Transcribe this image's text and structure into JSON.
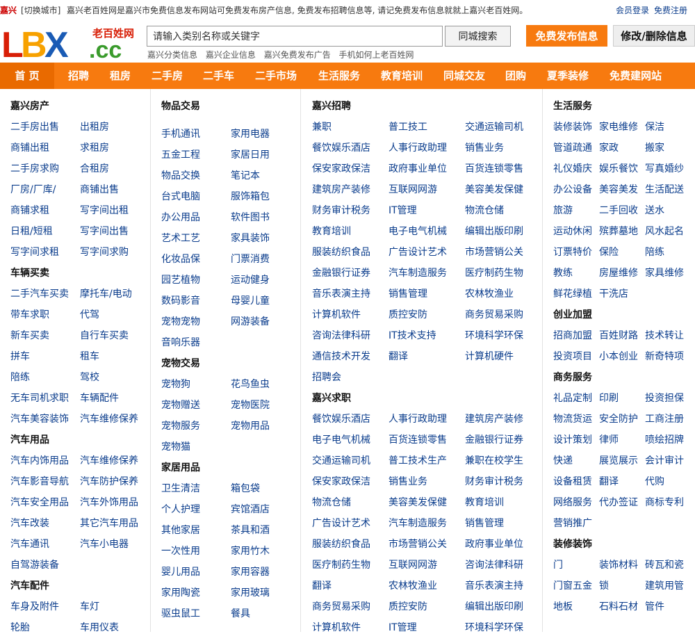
{
  "topbar": {
    "city": "嘉兴",
    "switch_city": "[切换城市]",
    "intro": "嘉兴老百姓网是嘉兴市免费信息发布网站可免费发布房产信息, 免费发布招聘信息等, 请记免费发布信息就就上嘉兴老百姓网。",
    "login": "会员登录",
    "register": "免费注册"
  },
  "logo": {
    "letters": "LBX",
    "domain": ".cc",
    "cn": "老百姓网",
    "colors": {
      "l": "#d81e06",
      "b": "#f7a100",
      "x": "#1a5bb5",
      "cc": "#3a9b2c",
      "cn": "#d81e06"
    }
  },
  "search": {
    "value": "请输入类别名称或关键字",
    "button": "同城搜索"
  },
  "actions": {
    "publish": "免费发布信息",
    "edit": "修改/删除信息"
  },
  "sublinks": [
    "嘉兴分类信息",
    "嘉兴企业信息",
    "嘉兴免费发布广告",
    "手机如何上老百姓网"
  ],
  "nav": [
    "首 页",
    "招聘",
    "租房",
    "二手房",
    "二手车",
    "二手市场",
    "生活服务",
    "教育培训",
    "同城交友",
    "团购",
    "夏季装修",
    "免费建网站"
  ],
  "columns": [
    {
      "sections": [
        {
          "title": "嘉兴房产",
          "links": [
            "二手房出售",
            "出租房",
            "商铺出租",
            "求租房",
            "二手房求购",
            "合租房",
            "厂房/厂库/",
            "商铺出售",
            "商铺求租",
            "写字间出租",
            "日租/短租",
            "写字间出售",
            "写字间求租",
            "写字间求购"
          ]
        },
        {
          "title": "车辆买卖",
          "links": [
            "二手汽车买卖",
            "摩托车/电动",
            "带车求职",
            "代驾",
            "新车买卖",
            "自行车买卖",
            "拼车",
            "租车",
            "陪练",
            "驾校",
            "无车司机求职",
            "车辆配件",
            "汽车美容装饰",
            "汽车维修保养"
          ]
        },
        {
          "title": "汽车用品",
          "links": [
            "汽车内饰用品",
            "汽车维修保养",
            "汽车影音导航",
            "汽车防护保养",
            "汽车安全用品",
            "汽车外饰用品",
            "汽车改装",
            "其它汽车用品",
            "汽车通讯",
            "汽车小电器",
            "自驾游装备"
          ]
        },
        {
          "title": "汽车配件",
          "links": [
            "车身及附件",
            "车灯",
            "轮胎",
            "车用仪表"
          ]
        }
      ]
    },
    {
      "sections": [
        {
          "title": "物品交易",
          "links": [
            "手机通讯",
            "家用电器",
            "五金工程",
            "家居日用",
            "物品交换",
            "笔记本",
            "台式电脑",
            "服饰箱包",
            "办公用品",
            "软件图书",
            "艺术工艺",
            "家具装饰",
            "化妆品保",
            "门票消费",
            "园艺植物",
            "运动健身",
            "数码影音",
            "母婴儿童",
            "宠物宠物",
            "网游装备",
            "音响乐器"
          ]
        },
        {
          "title": "宠物交易",
          "links": [
            "宠物狗",
            "花鸟鱼虫",
            "宠物赠送",
            "宠物医院",
            "宠物服务",
            "宠物用品",
            "宠物猫"
          ]
        },
        {
          "title": "家居用品",
          "links": [
            "卫生清洁",
            "箱包袋",
            "个人护理",
            "宾馆酒店",
            "其他家居",
            "茶具和酒",
            "一次性用",
            "家用竹木",
            "婴儿用品",
            "家用容器",
            "家用陶瓷",
            "家用玻璃",
            "驱虫鼠工",
            "餐具"
          ]
        }
      ]
    },
    {
      "sections": [
        {
          "title": "嘉兴招聘",
          "links": [
            "兼职",
            "普工技工",
            "交通运输司机",
            "餐饮娱乐酒店",
            "人事行政助理",
            "销售业务",
            "保安家政保洁",
            "政府事业单位",
            "百货连锁零售",
            "建筑房产装修",
            "互联网网游",
            "美容美发保健",
            "财务审计税务",
            "IT管理",
            "物流仓储",
            "教育培训",
            "电子电气机械",
            "编辑出版印刷",
            "服装纺织食品",
            "广告设计艺术",
            "市场营销公关",
            "金融银行证券",
            "汽车制造服务",
            "医疗制药生物",
            "音乐表演主持",
            "销售管理",
            "农林牧渔业",
            "计算机软件",
            "质控安防",
            "商务贸易采购",
            "咨询法律科研",
            "IT技术支持",
            "环境科学环保",
            "通信技术开发",
            "翻译",
            "计算机硬件",
            "招聘会"
          ]
        },
        {
          "title": "嘉兴求职",
          "links": [
            "餐饮娱乐酒店",
            "人事行政助理",
            "建筑房产装修",
            "电子电气机械",
            "百货连锁零售",
            "金融银行证券",
            "交通运输司机",
            "普工技术生产",
            "兼职在校学生",
            "保安家政保洁",
            "销售业务",
            "财务审计税务",
            "物流仓储",
            "美容美发保健",
            "教育培训",
            "广告设计艺术",
            "汽车制造服务",
            "销售管理",
            "服装纺织食品",
            "市场营销公关",
            "政府事业单位",
            "医疗制药生物",
            "互联网网游",
            "咨询法律科研",
            "翻译",
            "农林牧渔业",
            "音乐表演主持",
            "商务贸易采购",
            "质控安防",
            "编辑出版印刷",
            "计算机软件",
            "IT管理",
            "环境科学环保"
          ]
        }
      ]
    },
    {
      "sections": [
        {
          "title": "生活服务",
          "links": [
            "装修装饰",
            "家电维修",
            "保洁",
            "管道疏通",
            "家政",
            "搬家",
            "礼仪婚庆",
            "娱乐餐饮",
            "写真婚纱",
            "办公设备",
            "美容美发",
            "生活配送",
            "旅游",
            "二手回收",
            "送水",
            "运动休闲",
            "殡葬墓地",
            "风水起名",
            "订票特价",
            "保险",
            "陪练",
            "教练",
            "房屋维修",
            "家具维修",
            "鲜花绿植",
            "干洗店"
          ]
        },
        {
          "title": "创业加盟",
          "links": [
            "招商加盟",
            "百姓财路",
            "技术转让",
            "投资项目",
            "小本创业",
            "新奇特项"
          ]
        },
        {
          "title": "商务服务",
          "links": [
            "礼品定制",
            "印刷",
            "投资担保",
            "物流货运",
            "安全防护",
            "工商注册",
            "设计策划",
            "律师",
            "喷绘招牌",
            "快递",
            "展览展示",
            "会计审计",
            "设备租赁",
            "翻译",
            "代购",
            "网络服务",
            "代办签证",
            "商标专利",
            "营销推广"
          ]
        },
        {
          "title": "装修装饰",
          "links": [
            "门",
            "装饰材料",
            "砖瓦和瓷",
            "门窗五金",
            "锁",
            "建筑用管",
            "地板",
            "石料石材",
            "管件"
          ]
        }
      ]
    }
  ]
}
